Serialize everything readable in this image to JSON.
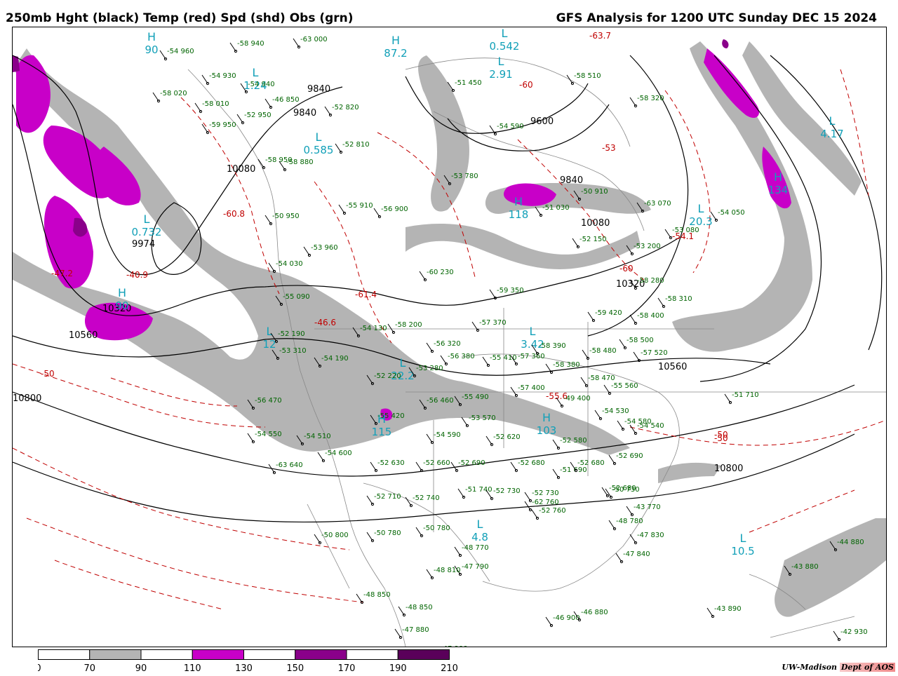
{
  "header": {
    "left_title": "250mb Hght (black) Temp (red) Spd (shd) Obs (grn)",
    "right_title": "GFS Analysis for 1200 UTC Sunday  DEC 15 2024"
  },
  "colors": {
    "height": "#000000",
    "temp": "#c00000",
    "obs": "#006400",
    "center_label": "#12a0b8",
    "speed_70_90": "#b4b4b4",
    "speed_110_130": "#c800c8",
    "speed_150_170": "#8a008a",
    "speed_190_210": "#5a005a"
  },
  "legend": {
    "ticks": [
      "0",
      "70",
      "90",
      "110",
      "130",
      "150",
      "170",
      "190",
      "210"
    ],
    "fills": [
      "#ffffff",
      "#b4b4b4",
      "#ffffff",
      "#c800c8",
      "#ffffff",
      "#8a008a",
      "#ffffff",
      "#5a005a"
    ]
  },
  "height_labels": [
    "9840",
    "9600",
    "10080",
    "9974",
    "10320",
    "10560",
    "10800",
    "9840",
    "10080",
    "10320",
    "10560",
    "10800",
    "9840"
  ],
  "temp_labels": [
    "-63.7",
    "-60.8",
    "-40.9",
    "-47.2",
    "-61.4",
    "-46.6",
    "-60",
    "-53",
    "-54.1",
    "-60",
    "-50",
    "-50",
    "-55.6",
    "-50"
  ],
  "centers": [
    {
      "letter": "H",
      "value": "87.2"
    },
    {
      "letter": "L",
      "value": "1.24"
    },
    {
      "letter": "L",
      "value": "0.542"
    },
    {
      "letter": "L",
      "value": "2.91"
    },
    {
      "letter": "L",
      "value": "0.585"
    },
    {
      "letter": "L",
      "value": "0.732"
    },
    {
      "letter": "H",
      "value": "118"
    },
    {
      "letter": "L",
      "value": "3.42"
    },
    {
      "letter": "L",
      "value": "4.17"
    },
    {
      "letter": "H",
      "value": "134"
    },
    {
      "letter": "L",
      "value": "20.3"
    },
    {
      "letter": "H",
      "value": "115"
    },
    {
      "letter": "H",
      "value": "103"
    },
    {
      "letter": "L",
      "value": "4.8"
    },
    {
      "letter": "L",
      "value": "10.5"
    },
    {
      "letter": "L",
      "value": "12"
    },
    {
      "letter": "L",
      "value": "22.2"
    },
    {
      "letter": "H",
      "value": "90"
    },
    {
      "letter": "H",
      "value": "90"
    }
  ],
  "obs": [
    "-54 960",
    "-58 940",
    "-63 000",
    "-54 930",
    "-54 940",
    "-58 020",
    "-58 010",
    "-46 850",
    "-52 950",
    "-59 950",
    "-52 820",
    "-51 450",
    "-54 590",
    "-58 510",
    "-58 320",
    "-52 810",
    "-58 950",
    "-58 880",
    "-53 780",
    "-55 910",
    "-56 900",
    "-50 950",
    "-53 960",
    "-54 030",
    "-50 910",
    "-63 070",
    "-54 050",
    "-53 080",
    "-52 150",
    "-53 200",
    "-51 030",
    "-60 230",
    "-55 090",
    "-59 350",
    "-58 280",
    "-58 310",
    "-54 130",
    "-58 200",
    "-56 320",
    "-57 370",
    "-59 420",
    "-58 400",
    "-52 190",
    "-53 310",
    "-54 190",
    "-52 220",
    "-56 380",
    "-55 410",
    "-57 360",
    "-58 390",
    "-58 380",
    "-58 480",
    "-57 520",
    "-58 500",
    "-57 400",
    "-53 280",
    "-56 470",
    "-56 460",
    "-55 490",
    "-55 420",
    "-49 400",
    "-58 470",
    "-55 560",
    "-54 530",
    "-54 580",
    "-54 540",
    "-53 570",
    "-54 550",
    "-54 510",
    "-54 590",
    "-54 600",
    "-52 620",
    "-51 710",
    "-63 640",
    "-52 630",
    "-52 660",
    "-52 690",
    "-52 680",
    "-51 690",
    "-52 680",
    "-52 690",
    "-52 580",
    "-52 680",
    "-52 710",
    "-52 740",
    "-51 740",
    "-52 730",
    "-52 730",
    "-52 760",
    "-62 760",
    "-50 730",
    "-43 770",
    "-48 780",
    "-47 830",
    "-47 840",
    "-50 800",
    "-50 780",
    "-50 780",
    "-48 770",
    "-47 790",
    "-48 810",
    "-44 880",
    "-43 880",
    "-48 850",
    "-48 850",
    "-47 880",
    "-46 890",
    "-47 900",
    "-46 900",
    "-46 880",
    "-43 890",
    "-42 930"
  ],
  "credit": {
    "org": "UW-Madison",
    "dept": "Dept of AOS"
  }
}
